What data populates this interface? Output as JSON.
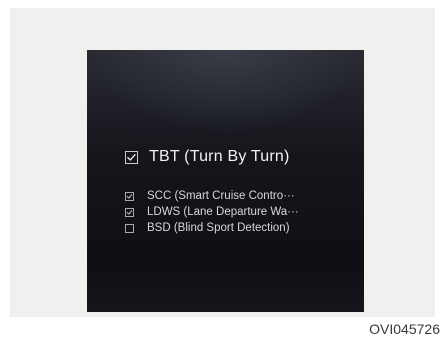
{
  "screen": {
    "main_option": {
      "label": "TBT (Turn By Turn)",
      "checked": true
    },
    "sub_options": [
      {
        "label": "SCC (Smart Cruise Contro···",
        "checked": true
      },
      {
        "label": "LDWS (Lane Departure Wa···",
        "checked": true
      },
      {
        "label": "BSD (Blind Sport Detection)",
        "checked": false
      }
    ]
  },
  "figure_code": "OVI045726",
  "colors": {
    "panel_background": "#f1f0ee",
    "screen_background": "#0b0c11",
    "text_primary": "#f2f2f2",
    "checkbox_border": "#c9cacd"
  }
}
